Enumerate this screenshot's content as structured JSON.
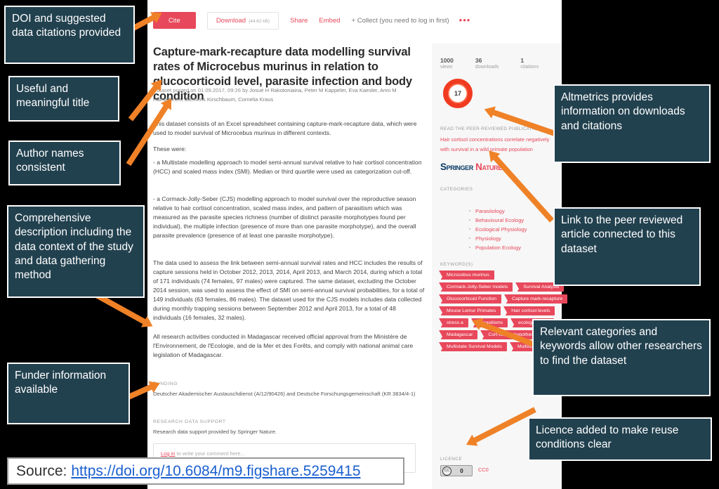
{
  "source_bar": {
    "label": "Source:",
    "url": "https://doi.org/10.6084/m9.figshare.5259415"
  },
  "toolbar": {
    "cite_label": "Cite",
    "download_label": "Download",
    "download_size": "(44.62 kB)",
    "share_label": "Share",
    "embed_label": "Embed",
    "collect_label": "+ Collect (you need to log in first)",
    "more_label": "•••"
  },
  "dataset": {
    "title": "Capture-mark-recapture data modelling survival rates of Microcebus murinus in relation to glucocorticoid level, parasite infection and body condition",
    "posted_prefix": "Dataset posted on 01.09.2017, 09:26 by",
    "authors": "Josué H Rakotoniaina,  Peter M Kappeler,  Eva Kaesler,  Anni M Hämäläinen,  Clemens Kirschbaum,  Cornelia Kraus",
    "paragraphs": [
      "This dataset consists of an Excel spreadsheet containing capture-mark-recapture data, which were used to model survival of Microcebus murinus in different contexts.",
      "These were:",
      "- a Multistate modelling approach to model semi-annual survival relative to hair cortisol concentration (HCC) and scaled mass index (SMI). Median or third quartile were used as categorization cut-off.",
      "- a Cormack-Jolly-Seber (CJS) modelling approach to model survival over the reproductive season relative to hair cortisol concentration, scaled mass index, and pattern of parasitism which was measured as the parasite species richness (number of distinct parasite morphotypes found per individual), the multiple infection (presence of more than one parasite morphotype), and the overall parasite prevalence (presence of at least one parasite morphotype).",
      "The data used to assess the link between semi-annual survival rates and HCC includes the results of capture sessions held in October 2012, 2013, 2014, April 2013, and March 2014, during which a total of 171 individuals (74 females, 97 males) were captured. The same dataset, excluding the October 2014 session, was used to assess the effect of SMI on semi-annual survival probabilities, for a total of 149 individuals (63 females, 86 males). The dataset used for the CJS models includes data collected during monthly trapping sessions between September 2012 and April 2013, for a total of 48 individuals (16 females, 32 males).",
      "All research activities conducted in Madagascar received official approval from the Ministère de l'Environnement, de l'Ecologie, and de la Mer et des Forêts, and comply with national animal care legislation of Madagascar."
    ],
    "funding_heading": "FUNDING",
    "funding_text": "Deutscher Akademischer Austauschdienst (A/12/90426) and Deutsche Forschungsgemeinschaft (KR 3834/4-1)",
    "rds_heading": "RESEARCH DATA SUPPORT",
    "rds_text": "Research data support provided by Springer Nature.",
    "comment_login": "Log in",
    "comment_placeholder": "to write your comment here..."
  },
  "sidebar": {
    "stats": [
      {
        "number": "1000",
        "label": "views"
      },
      {
        "number": "36",
        "label": "downloads"
      },
      {
        "number": "1",
        "label": "citations"
      }
    ],
    "altmetric_score": "17",
    "read_heading": "READ THE PEER-REVIEWED PUBLICATION:",
    "read_link": "Hair cortisol concentrations correlate negatively with survival in a wild primate population",
    "publisher_left": "Springer",
    "publisher_right": "Nature",
    "categories_heading": "CATEGORIES",
    "categories": [
      "Parasitology",
      "Behavioural Ecology",
      "Ecological Physiology",
      "Physiology",
      "Population Ecology"
    ],
    "keywords_heading": "KEYWORD(S)",
    "keywords": [
      "Microcebus murinus",
      "Cormack-Jolly-Seber models",
      "Survival Analysis",
      "Glucocorticoid Function",
      "Capture mark-recapture",
      "Mouse Lemur Primates",
      "Hair cortisol levels",
      "stress a",
      "parasitisms",
      "ecological stre",
      "Madagascar",
      "Cort-fitness hypothesis",
      "Multistate Survival Models",
      "Multistate models"
    ],
    "licence_heading": "LICENCE",
    "licence_value": "CC0",
    "licence_badge_cc": "CC",
    "licence_badge_zero": "0"
  },
  "annotations": [
    {
      "id": "doi-citations",
      "text": "DOI and suggested data citations provided"
    },
    {
      "id": "title",
      "text": "Useful and meaningful title"
    },
    {
      "id": "authors",
      "text": "Author names consistent"
    },
    {
      "id": "description",
      "text": "Comprehensive description including the data context of the study and data gathering method"
    },
    {
      "id": "funder",
      "text": "Funder information available"
    },
    {
      "id": "altmetrics",
      "text": "Altmetrics provides information on downloads and citations"
    },
    {
      "id": "peer-link",
      "text": "Link to the peer reviewed article connected to this dataset"
    },
    {
      "id": "categories",
      "text": "Relevant categories and keywords allow other researchers to find the dataset"
    },
    {
      "id": "licence",
      "text": "Licence added to make reuse conditions clear"
    }
  ],
  "colors": {
    "accent": "#e8485b",
    "callout_bg": "#22414f",
    "arrow": "#ef8127",
    "link": "#1a5fd0"
  }
}
